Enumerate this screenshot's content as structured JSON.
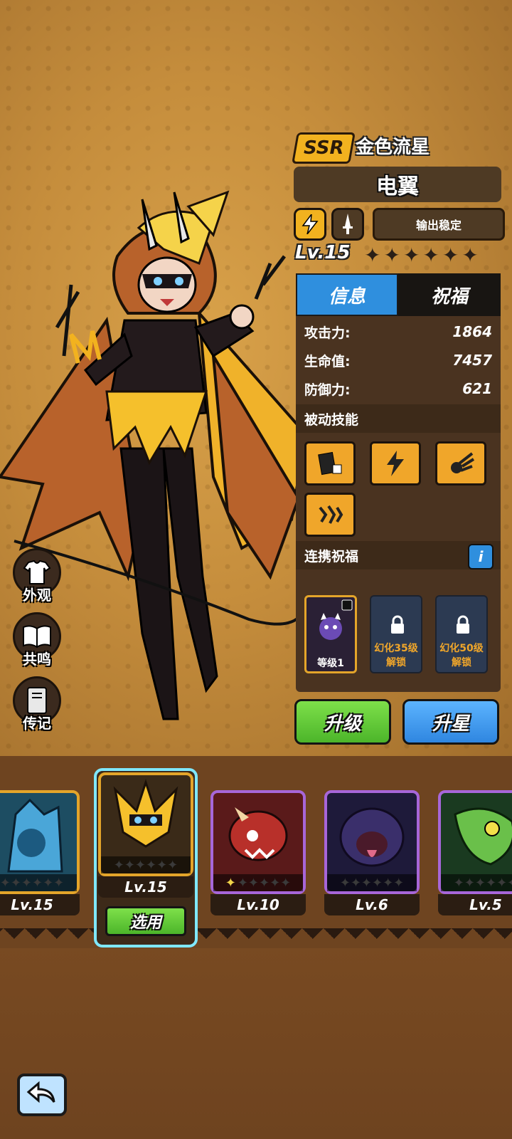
{
  "hero": {
    "rarity": "SSR",
    "title": "金色流星",
    "name": "电翼",
    "tag": "输出稳定",
    "level": "Lv.15",
    "star_count": 6
  },
  "side_menu": {
    "appearance": "外观",
    "resonance": "共鸣",
    "biography": "传记"
  },
  "panel": {
    "tab_info": "信息",
    "tab_blessing": "祝福",
    "stats": [
      {
        "label": "攻击力:",
        "value": "1864"
      },
      {
        "label": "生命值:",
        "value": "7457"
      },
      {
        "label": "防御力:",
        "value": "621"
      }
    ],
    "passive_title": "被动技能",
    "link_title": "连携祝福",
    "info_icon": "i",
    "blessings": [
      {
        "text": "等级1"
      },
      {
        "line1": "幻化35级",
        "line2": "解锁"
      },
      {
        "line1": "幻化50级",
        "line2": "解锁"
      }
    ]
  },
  "actions": {
    "upgrade": "升级",
    "star_up": "升星"
  },
  "roster": [
    {
      "level": "Lv.15",
      "frame": "#e4a52a"
    },
    {
      "level": "Lv.15",
      "frame": "#e4a52a",
      "select_label": "选用"
    },
    {
      "level": "Lv.10",
      "frame": "#a766d9"
    },
    {
      "level": "Lv.6",
      "frame": "#a766d9"
    },
    {
      "level": "Lv.5",
      "frame": "#a766d9"
    }
  ],
  "colors": {
    "accent_blue": "#2f8fde",
    "accent_green": "#4cb52a",
    "rarity_gold": "#f2b21f"
  }
}
